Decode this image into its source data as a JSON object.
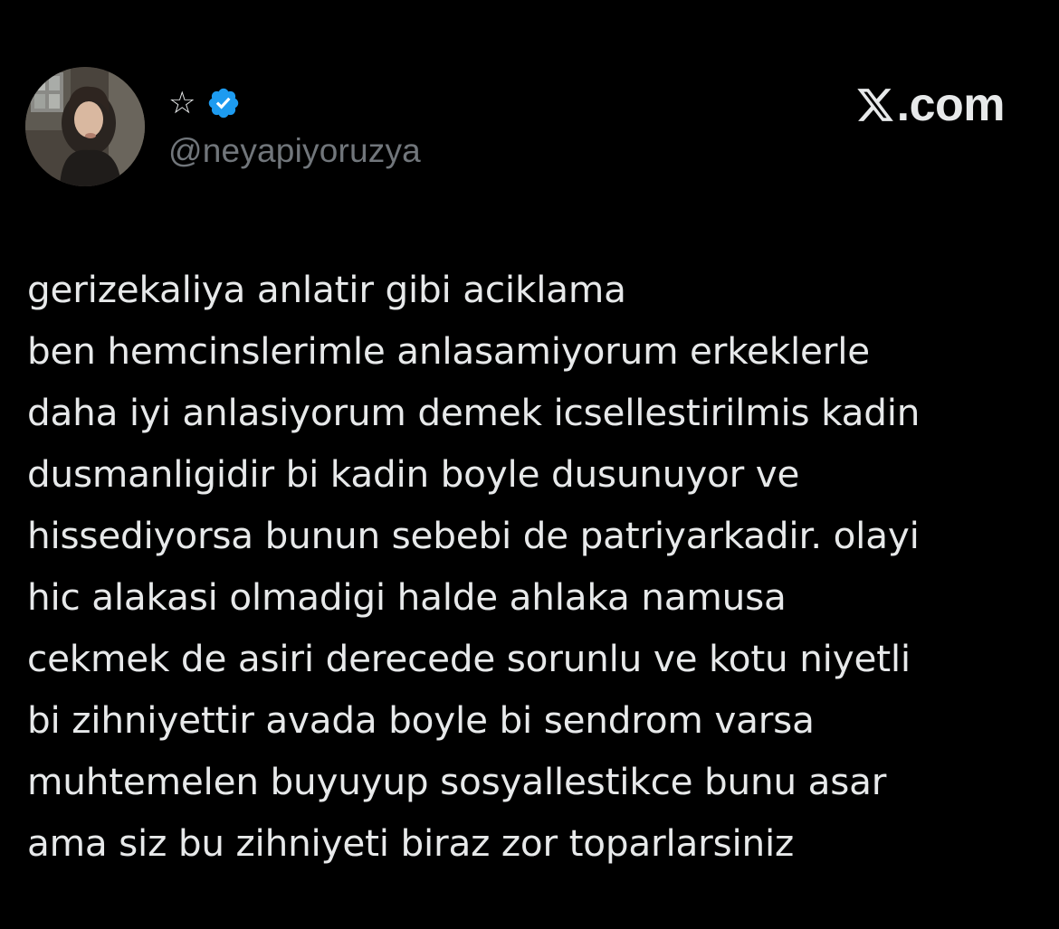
{
  "tweet": {
    "author": {
      "display_name": "☆",
      "handle": "@neyapiyoruzya",
      "verified": true,
      "verified_color": "#1d9bf0",
      "avatar_icon": "profile-photo"
    },
    "brand": {
      "logo_icon": "x-logo-icon",
      "text": ".com"
    },
    "lines": [
      "gerizekaliya anlatir gibi aciklama",
      "ben hemcinslerimle anlasamiyorum erkeklerle",
      "daha iyi anlasiyorum demek icsellestirilmis kadin",
      "dusmanligidir bi kadin boyle dusunuyor ve",
      "hissediyorsa bunun sebebi de patriyarkadir. olayi",
      "hic alakasi olmadigi halde ahlaka namusa",
      "cekmek de asiri derecede sorunlu ve kotu niyetli",
      "bi zihniyettir avada boyle bi sendrom varsa",
      "muhtemelen buyuyup sosyallestikce bunu asar",
      "ama siz bu zihniyeti biraz zor toparlarsiniz"
    ]
  },
  "colors": {
    "background": "#000000",
    "text_primary": "#e7e9ea",
    "text_secondary": "#71767b"
  }
}
